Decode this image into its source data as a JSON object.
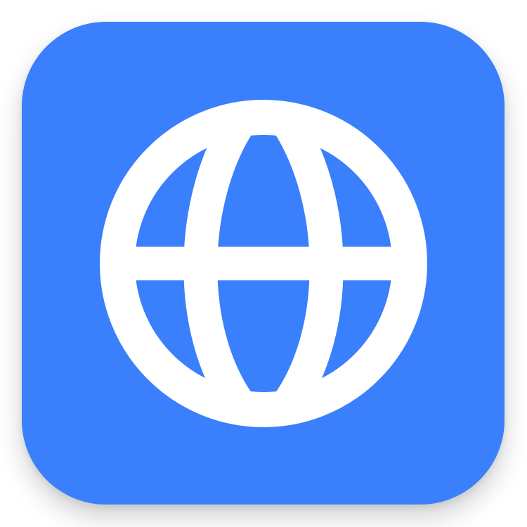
{
  "app_icon": {
    "icon": "globe-icon",
    "colors": {
      "background": "#3a7ffc",
      "glyph": "#ffffff"
    }
  }
}
